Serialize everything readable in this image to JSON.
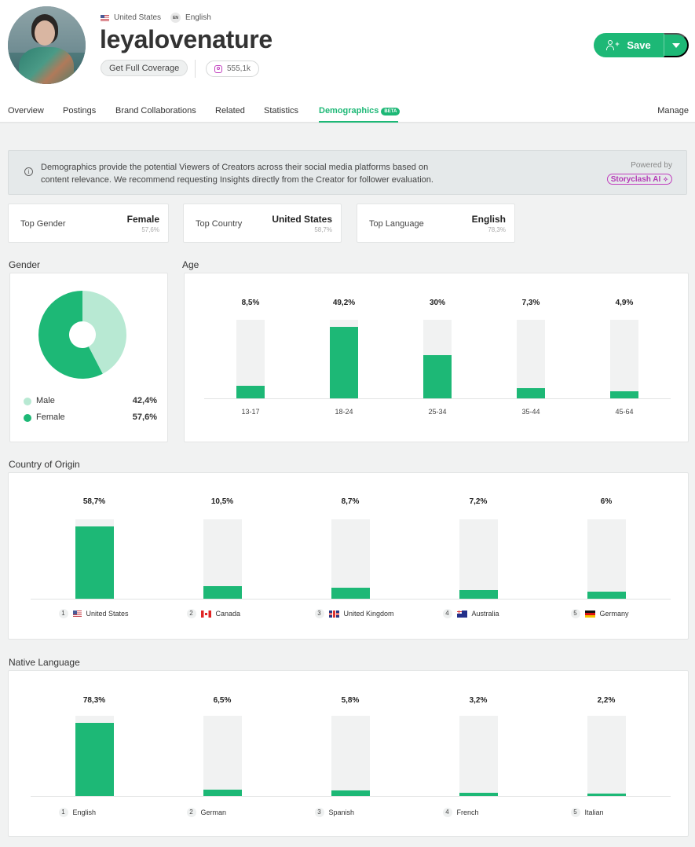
{
  "profile": {
    "country": "United States",
    "language_code": "EN",
    "language": "English",
    "username": "leyalovenature",
    "coverage_button": "Get Full Coverage",
    "instagram_followers": "555,1k",
    "save_label": "Save"
  },
  "tabs": [
    {
      "label": "Overview",
      "active": false
    },
    {
      "label": "Postings",
      "active": false
    },
    {
      "label": "Brand Collaborations",
      "active": false
    },
    {
      "label": "Related",
      "active": false
    },
    {
      "label": "Statistics",
      "active": false
    },
    {
      "label": "Demographics",
      "active": true,
      "badge": "BETA"
    }
  ],
  "manage_label": "Manage",
  "info": {
    "icon": "info-icon",
    "text": "Demographics provide the potential Viewers of Creators across their social media platforms based on content relevance. We recommend requesting Insights directly from the Creator for follower evaluation.",
    "powered_by": "Powered by",
    "brand": "Storyclash AI"
  },
  "top_cards": [
    {
      "label": "Top Gender",
      "value": "Female",
      "percent": "57,6%"
    },
    {
      "label": "Top Country",
      "value": "United States",
      "percent": "58,7%"
    },
    {
      "label": "Top Language",
      "value": "English",
      "percent": "78,3%"
    }
  ],
  "colors": {
    "accent": "#1db876",
    "accent_light": "#b8e9d3",
    "track": "#f1f2f2",
    "brand_ai": "#c13fbe"
  },
  "chart_data": [
    {
      "type": "pie",
      "title": "Gender",
      "categories": [
        "Male",
        "Female"
      ],
      "values": [
        42.4,
        57.6
      ],
      "labels": [
        "42,4%",
        "57,6%"
      ],
      "colors": [
        "#b8e9d3",
        "#1db876"
      ],
      "legend": "bottom"
    },
    {
      "type": "bar",
      "title": "Age",
      "categories": [
        "13-17",
        "18-24",
        "25-34",
        "35-44",
        "45-64"
      ],
      "values": [
        8.5,
        49.2,
        30,
        7.3,
        4.9
      ],
      "labels": [
        "8,5%",
        "49,2%",
        "30%",
        "7,3%",
        "4,9%"
      ],
      "ylim": [
        0,
        54.1
      ]
    },
    {
      "type": "bar",
      "title": "Country of Origin",
      "categories": [
        "United States",
        "Canada",
        "United Kingdom",
        "Australia",
        "Germany"
      ],
      "ranks": [
        "1",
        "2",
        "3",
        "4",
        "5"
      ],
      "flags": [
        "flag-us",
        "flag-ca",
        "flag-uk",
        "flag-au",
        "flag-de"
      ],
      "values": [
        58.7,
        10.5,
        8.7,
        7.2,
        6
      ],
      "labels": [
        "58,7%",
        "10,5%",
        "8,7%",
        "7,2%",
        "6%"
      ],
      "ylim": [
        0,
        64.6
      ]
    },
    {
      "type": "bar",
      "title": "Native Language",
      "categories": [
        "English",
        "German",
        "Spanish",
        "French",
        "Italian"
      ],
      "ranks": [
        "1",
        "2",
        "3",
        "4",
        "5"
      ],
      "values": [
        78.3,
        6.5,
        5.8,
        3.2,
        2.2
      ],
      "labels": [
        "78,3%",
        "6,5%",
        "5,8%",
        "3,2%",
        "2,2%"
      ],
      "ylim": [
        0,
        86.1
      ]
    }
  ]
}
